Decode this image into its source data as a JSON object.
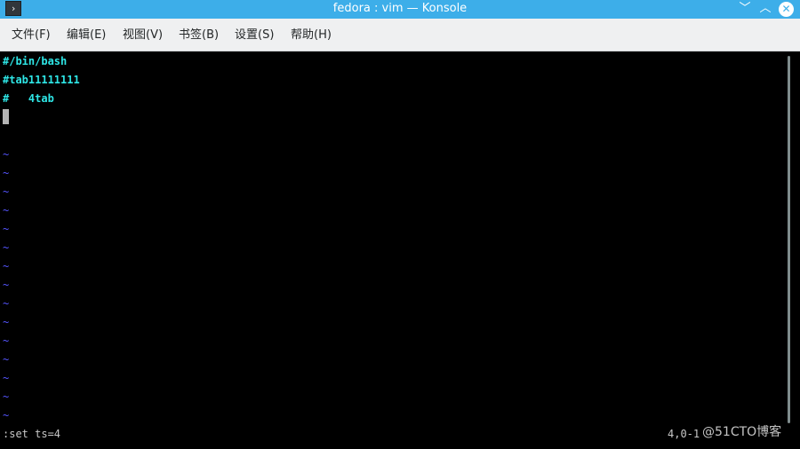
{
  "window": {
    "title": "fedora : vim — Konsole",
    "app_icon": "terminal-icon",
    "controls": {
      "minimize_glyph": "﹀",
      "maximize_glyph": "︿",
      "close_glyph": "✕"
    }
  },
  "menu": [
    {
      "label": "文件(F)"
    },
    {
      "label": "编辑(E)"
    },
    {
      "label": "视图(V)"
    },
    {
      "label": "书签(B)"
    },
    {
      "label": "设置(S)"
    },
    {
      "label": "帮助(H)"
    }
  ],
  "editor": {
    "lines": [
      "#/bin/bash",
      "#tab11111111",
      "#   4tab"
    ],
    "empty_marker": "~",
    "command_line": ":set ts=4",
    "ruler": "4,0-1"
  },
  "watermark": "@51CTO博客",
  "colors": {
    "titlebar": "#3daee9",
    "menubar": "#eff0f1",
    "text_cyan": "#2ee6e6",
    "tilde_blue": "#5555ff",
    "background": "#000000"
  }
}
